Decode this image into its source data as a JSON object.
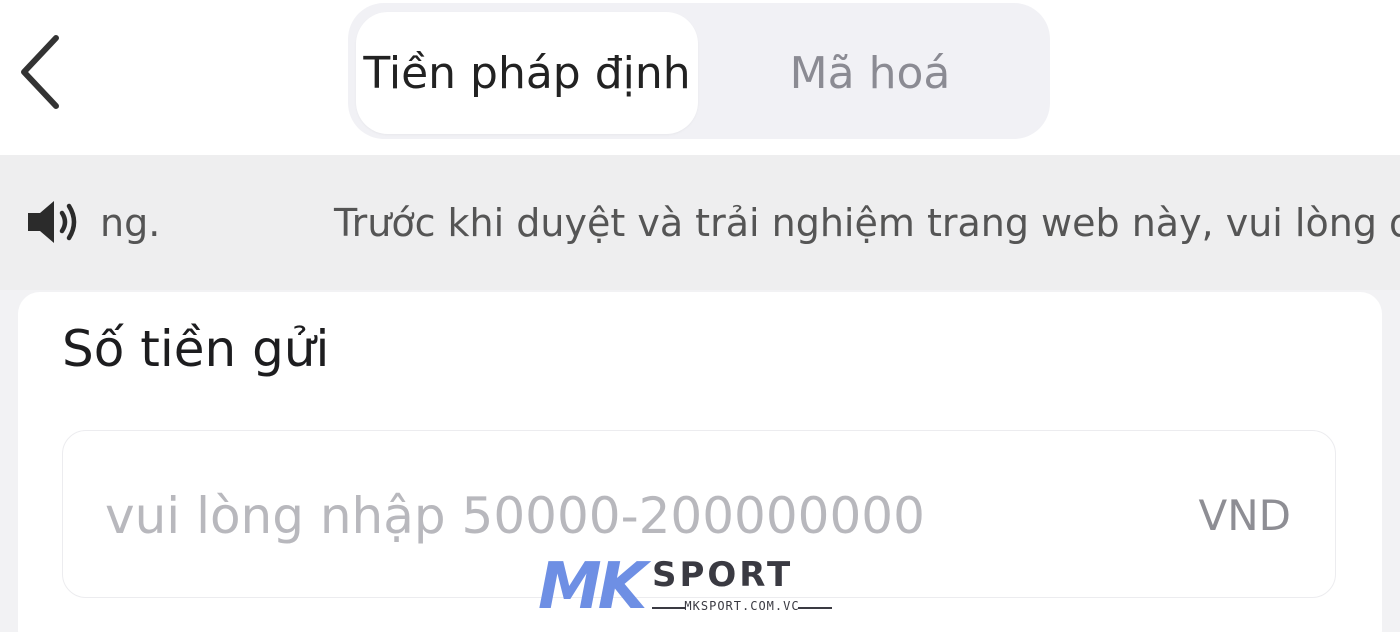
{
  "header": {
    "tabs": [
      {
        "label": "Tiền pháp định",
        "active": true
      },
      {
        "label": "Mã hoá",
        "active": false
      }
    ]
  },
  "notice": {
    "icon": "speaker-icon",
    "tail_text": "ng.",
    "text": "Trước khi duyệt và trải nghiệm trang web này, vui lòng đản"
  },
  "deposit": {
    "title": "Số tiền gửi",
    "placeholder": "vui lòng nhập 50000-200000000",
    "value": "",
    "currency": "VND"
  },
  "watermark": {
    "brand_mark": "MK",
    "brand_name": "SPORT",
    "url": "MKSPORT.COM.VC"
  },
  "colors": {
    "tab_active_bg": "#ffffff",
    "segmented_bg": "#f1f1f5",
    "notice_bg": "#eeeeef",
    "placeholder": "#b8b8bd",
    "watermark_accent": "#6e8fe4"
  }
}
